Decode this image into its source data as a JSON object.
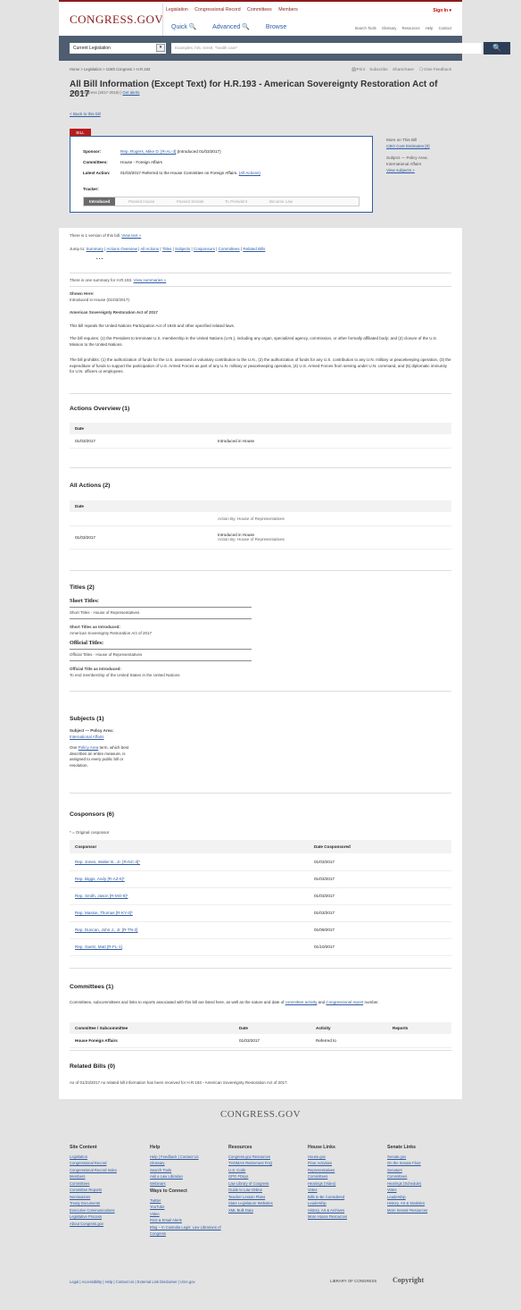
{
  "header": {
    "logo": "CONGRESS.GOV",
    "nav": [
      "Legislation",
      "Congressional Record",
      "Committees",
      "Members"
    ],
    "signin": "Sign In ▾",
    "quick": "Quick 🔍",
    "advanced": "Advanced 🔍",
    "browse": "Browse",
    "utility": [
      "Search Tools",
      "Glossary",
      "Resources",
      "Help",
      "Contact"
    ]
  },
  "search": {
    "select": "Current Legislation",
    "placeholder": "Examples: hr5, sres9, \"health care\"",
    "button": "🔍"
  },
  "breadcrumb": "Home > Legislation > 115th Congress > H.R.193",
  "page_actions": [
    "🖨Print",
    "Subscribe",
    "Share/Save",
    "🗨Give Feedback"
  ],
  "title": "All Bill Information (Except Text) for H.R.193 - American Sovereignty Restoration Act of 2017",
  "subtitle": "115th Congress (2017-2018) |",
  "get_alerts": "Get alerts",
  "back_link": "< Back to this bill",
  "overview": {
    "tag": "BILL",
    "sponsor_label": "Sponsor:",
    "sponsor_link": "Rep. Rogers, Mike D. [R-AL-3]",
    "sponsor_rest": " (Introduced 01/03/2017)",
    "committees_label": "Committees:",
    "committees": "House - Foreign Affairs",
    "latest_label": "Latest Action:",
    "latest": "01/03/2017 Referred to the House Committee on Foreign Affairs.",
    "all_actions": "(All Actions)",
    "tracker_label": "Tracker:",
    "steps": [
      "Introduced",
      "Passed House",
      "Passed Senate",
      "To President",
      "Became Law"
    ]
  },
  "side": {
    "more": "More on This Bill",
    "cbo": "CBO Cost Estimates [0]",
    "subject": "Subject — Policy Area:",
    "area": "International Affairs",
    "view_subjects": "View subjects »"
  },
  "versions": "There is 1 version of this bill.",
  "view_text": "View text »",
  "jump_label": "Jump to:",
  "jump": [
    "Summary",
    "Actions Overview",
    "All Actions",
    "Titles",
    "Subjects",
    "Cosponsors",
    "Committees",
    "Related Bills"
  ],
  "dots": "•  •  •",
  "summary_count": "There is one summary for H.R.193.",
  "view_summaries": "View summaries »",
  "shown_here": "Shown Here:",
  "shown_here_val": "Introduced in House (01/03/2017)",
  "act_name": "American Sovereignty Restoration Act of 2017",
  "p1": "This bill repeals the United Nations Participation Act of 1945 and other specified related laws.",
  "p2": "The bill requires: (1) the President to terminate U.S. membership in the United Nations (U.N.), including any organ, specialized agency, commission, or other formally affiliated body; and (2) closure of the U.S. Mission to the United Nations.",
  "p3": "The bill prohibits: (1) the authorization of funds for the U.S. assessed or voluntary contribution to the U.N., (2) the authorization of funds for any U.S. contribution to any U.N. military or peacekeeping operation, (3) the expenditure of funds to support the participation of U.S. Armed Forces as part of any U.N. military or peacekeeping operation, (4) U.S. Armed Forces from serving under U.N. command, and (5) diplomatic immunity for U.N. officers or employees.",
  "actions_overview": {
    "heading": "Actions Overview (1)",
    "col": "Date",
    "rows": [
      [
        "01/03/2017",
        "Introduced in House"
      ]
    ]
  },
  "all_actions": {
    "heading": "All Actions (2)",
    "col": "Date",
    "row1": "Action By: House of Representatives",
    "row2_date": "01/03/2017",
    "row2_a": "Introduced in House",
    "row2_b": "Action By: House of Representatives"
  },
  "titles": {
    "heading": "Titles (2)",
    "short": "Short Titles:",
    "short_sub": "Short Titles - House of Representatives",
    "short_intro": "Short Titles as Introduced:",
    "short_val": "American Sovereignty Restoration Act of 2017",
    "official": "Official Titles:",
    "official_sub": "Official Titles - House of Representatives",
    "official_intro": "Official Title as Introduced:",
    "official_val": "To end membership of the United States in the United Nations."
  },
  "subjects": {
    "heading": "Subjects (1)",
    "label": "Subject — Policy Area:",
    "area": "International Affairs",
    "note_a": "One ",
    "note_link": "Policy Area",
    "note_b": " term, which best describes an entire measure, is assigned to every public bill or resolution."
  },
  "cosponsors": {
    "heading": "Cosponsors (6)",
    "note": "* = Original cosponsor",
    "col1": "Cosponsor",
    "col2": "Date Cosponsored",
    "rows": [
      [
        "Rep. Jones, Walter B., Jr. [R-NC-3]*",
        "01/03/2017"
      ],
      [
        "Rep. Biggs, Andy [R-AZ-5]*",
        "01/03/2017"
      ],
      [
        "Rep. Smith, Jason [R-MO-8]*",
        "01/03/2017"
      ],
      [
        "Rep. Massie, Thomas [R-KY-4]*",
        "01/03/2017"
      ],
      [
        "Rep. Duncan, John J., Jr. [R-TN-2]",
        "01/09/2017"
      ],
      [
        "Rep. Gaetz, Matt [R-FL-1]",
        "01/10/2017"
      ]
    ]
  },
  "committees": {
    "heading": "Committees (1)",
    "desc": "Committees, subcommittees and links to reports associated with this bill are listed here, as well as the nature and date of",
    "link1": "committee activity",
    "and": " and ",
    "link2": "Congressional report",
    "desc_end": " number.",
    "cols": [
      "Committee / Subcommittee",
      "Date",
      "Activity",
      "Reports"
    ],
    "row": [
      "House Foreign Affairs",
      "01/03/2017",
      "Referred to",
      ""
    ]
  },
  "related": {
    "heading": "Related Bills (0)",
    "text": "As of 01/23/2017 no related bill information has been received for H.R.193 - American Sovereignty Restoration Act of 2017."
  },
  "footer": {
    "logo": "CONGRESS.GOV",
    "cols": [
      {
        "title": "Site Content",
        "items": [
          "Legislation",
          "Congressional Record",
          "Congressional Record Index",
          "Members",
          "Committees",
          "Committee Reports",
          "Nominations",
          "Treaty Documents",
          "Executive Communications",
          "Legislative Process",
          "About Congress.gov"
        ]
      },
      {
        "title": "Help",
        "items": [
          "Help | Feedback | Contact Us",
          "Glossary",
          "Search Tools",
          "Ask a Law Librarian",
          "Webinars"
        ],
        "ways": "Ways to Connect",
        "ways_items": [
          "Twitter",
          "YouTube",
          "Video",
          "RSS & Email Alerts",
          "Blog – In Custodia Legis: Law Librarians of Congress"
        ]
      },
      {
        "title": "Resources",
        "items": [
          "Congress.gov Resources",
          "THOMAS Retirement FAQ",
          "U.S. Code",
          "GPO FDsys",
          "Law Library of Congress",
          "Guide to Law Online",
          "Teacher Lesson Plans",
          "State Legislature Websites",
          "XML Bulk Data"
        ]
      },
      {
        "title": "House Links",
        "items": [
          "House.gov",
          "Floor Activities",
          "Representatives",
          "Committees",
          "Hearings (Video)",
          "Votes",
          "Bills to Be Considered",
          "Leadership",
          "History, Art & Archives",
          "More House Resources"
        ]
      },
      {
        "title": "Senate Links",
        "items": [
          "Senate.gov",
          "On the Senate Floor",
          "Senators",
          "Committees",
          "Hearings (Schedule)",
          "Votes",
          "Leadership",
          "History, Art & Statistics",
          "More Senate Resources"
        ]
      }
    ],
    "bottom": "Legal | Accessibility | Help | Contact Us | External Link Disclaimer | USA.gov",
    "loc": "LIBRARY OF CONGRESS",
    "copy": "Copyright"
  }
}
